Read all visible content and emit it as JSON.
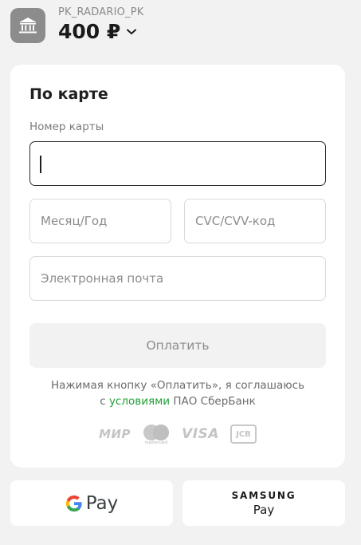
{
  "merchant": {
    "name": "PK_RADARIO_PK",
    "amount": "400 ₽",
    "icon": "bank-icon"
  },
  "form": {
    "title": "По карте",
    "card_number_label": "Номер карты",
    "card_number_value": "",
    "expiry_placeholder": "Месяц/Год",
    "cvc_placeholder": "CVC/CVV-код",
    "email_placeholder": "Электронная почта",
    "pay_button_label": "Оплатить"
  },
  "terms": {
    "text_before": "Нажимая кнопку «Оплатить», я соглашаюсь",
    "prefix": "с",
    "link": "условиями",
    "suffix": "ПАО СберБанк"
  },
  "card_brands": {
    "mir": "МИР",
    "mastercard": "mastercard",
    "visa": "VISA",
    "jcb": "JCB"
  },
  "wallets": {
    "google_pay_text": "Pay",
    "samsung_brand": "SAMSUNG",
    "samsung_pay": "Pay"
  },
  "colors": {
    "accent": "#21a038",
    "background": "#f2f2f2",
    "icon_grey": "#8c8c8c"
  }
}
